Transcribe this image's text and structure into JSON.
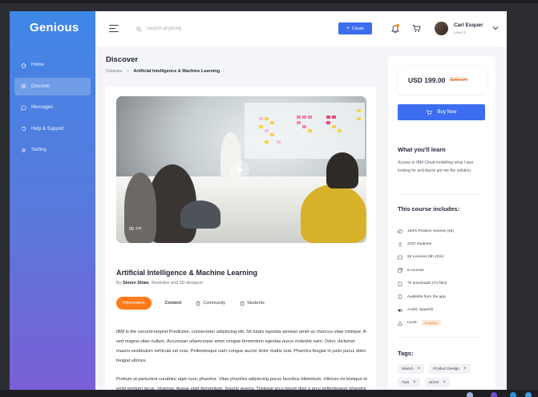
{
  "app": {
    "logo": "Genious"
  },
  "sidebar": {
    "items": [
      {
        "label": "Home",
        "icon": "home-icon"
      },
      {
        "label": "Discover",
        "icon": "list-icon",
        "active": true
      },
      {
        "label": "Messages",
        "icon": "chat-icon"
      },
      {
        "label": "Help & Support",
        "icon": "help-icon"
      },
      {
        "label": "Setting",
        "icon": "gear-icon"
      }
    ]
  },
  "header": {
    "search_placeholder": "Search anything",
    "create_label": "Create",
    "user": {
      "name": "Carl Esquer",
      "level": "Level 3"
    }
  },
  "page": {
    "title": "Discover",
    "breadcrumb": [
      "Courses",
      "Artificial Intelligence & Machine Learning"
    ]
  },
  "course": {
    "views": "240",
    "title": "Artificial Intelligence & Machine Learning",
    "by_prefix": "By",
    "author": "Simon Shaw",
    "author_role": ", Illustrator and 3D designer",
    "tabs": [
      "Information",
      "Content",
      "Community",
      "Students"
    ],
    "paragraphs": [
      "IBM is the second-largest Predictive, consectetur adipiscing elit. Sit turpis egestas aenean amet ac rhoncus vitae tristique. A sed magna vitae nullam. Accumsan ullamcorper amet congue fermentum egestas purus molestie nam. Dolor, dictumst mauris vestibulum vehicula vel cras. Pellentesque nam congue auctor dolor mattis orat. Pharetra feugiat in justo purus dolor feugiat ultrices.",
      "Pretium at parturient curabitur eget nunc pharetra. Vitae pharetra adipiscing purus faucibus bibendum. Ultrices mi tristique et enim pretium lacus, vivamus. Augue eget fermentum, mauris viverra. Tristique arcu ipsum duis a arcu pellentesque pharetra velit."
    ]
  },
  "purchase": {
    "price": "USD 199.00",
    "old_price": "$250.00",
    "buy_label": "Buy Now",
    "learn_title": "What you'll learn",
    "learn_text": "Access to IBM Cloud modelling what I was looking for and Aaron got me the solution.",
    "includes_title": "This course includes:",
    "includes": [
      {
        "icon": "thumbs-up-icon",
        "text": "100% Positive reviews (45)"
      },
      {
        "icon": "user-icon",
        "text": "2167 students"
      },
      {
        "icon": "video-icon",
        "text": "59 Lessons (8h 10m)"
      },
      {
        "icon": "stack-icon",
        "text": "6 courses"
      },
      {
        "icon": "document-icon",
        "text": "70 downloads (70 files)"
      },
      {
        "icon": "phone-icon",
        "text": "Available from the app"
      },
      {
        "icon": "audio-icon",
        "text": "Audio: Spanish"
      },
      {
        "icon": "level-icon",
        "text": "Level:",
        "badge": "Beginner"
      }
    ],
    "tags_title": "Tags:",
    "tags": [
      "Sketch",
      "Product Design",
      "Tuts",
      "UI/UX"
    ]
  }
}
